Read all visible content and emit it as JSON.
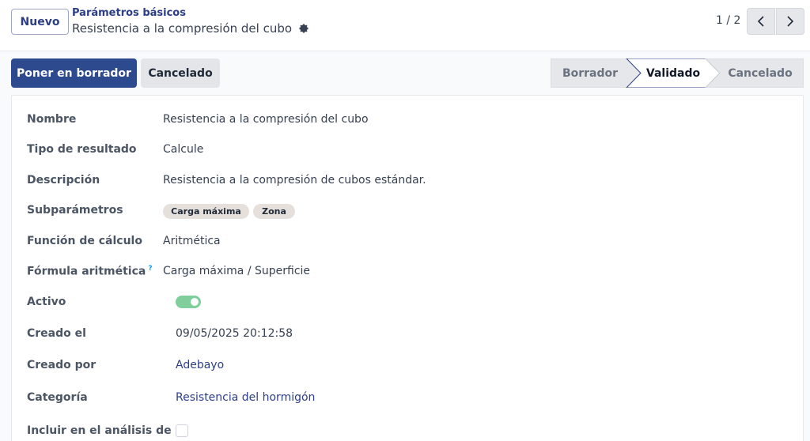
{
  "control_panel": {
    "new_button": "Nuevo",
    "breadcrumb": "Parámetros básicos",
    "record_title": "Resistencia a la compresión del cubo",
    "pager": "1 / 2"
  },
  "actions": {
    "set_draft": "Poner en borrador",
    "cancelled": "Cancelado"
  },
  "statusbar": {
    "steps": [
      "Borrador",
      "Validado",
      "Cancelado"
    ],
    "active": "Validado"
  },
  "form": {
    "name_label": "Nombre",
    "name_value": "Resistencia a la compresión del cubo",
    "result_type_label": "Tipo de resultado",
    "result_type_value": "Calcule",
    "description_label": "Descripción",
    "description_value": "Resistencia a la compresión de cubos estándar.",
    "subparams_label": "Subparámetros",
    "subparams_tags": [
      "Carga máxima",
      "Zona"
    ],
    "calc_function_label": "Función de cálculo",
    "calc_function_value": "Aritmética",
    "formula_label": "Fórmula aritmética",
    "formula_help": "?",
    "formula_value": "Carga máxima / Superficie",
    "active_label": "Activo",
    "active_value": true,
    "created_on_label": "Creado el",
    "created_on_value": "09/05/2025 20:12:58",
    "created_by_label": "Creado por",
    "created_by_value": "Adebayo",
    "category_label": "Categoría",
    "category_value": "Resistencia del hormigón",
    "include_analysis_label": "Incluir en el análisis de"
  },
  "colors": {
    "primary": "#2d4a8f",
    "link": "#2c3e85",
    "toggle_on": "#7fce9c",
    "status_inactive_bg": "#e5e7eb"
  }
}
